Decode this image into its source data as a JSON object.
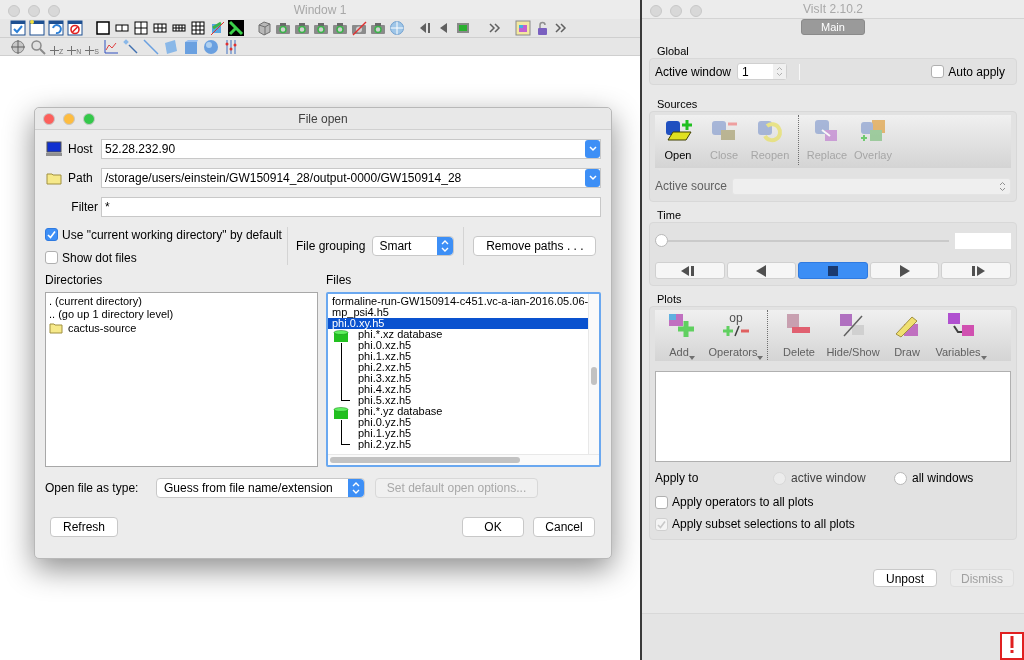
{
  "left_window": {
    "title": "Window 1",
    "toolbar_subscripts": [
      "Z",
      "N",
      "S"
    ]
  },
  "file_dialog": {
    "title": "File open",
    "host": {
      "label": "Host",
      "value": "52.28.232.90"
    },
    "path": {
      "label": "Path",
      "value": "/storage/users/einstein/GW150914_28/output-0000/GW150914_28"
    },
    "filter": {
      "label": "Filter",
      "value": "*"
    },
    "options": [
      {
        "label": "Use \"current working directory\" by default",
        "checked": true
      },
      {
        "label": "Show dot files",
        "checked": false
      }
    ],
    "file_grouping": {
      "label": "File grouping",
      "value": "Smart"
    },
    "remove_paths_button": "Remove paths . . .",
    "directories": {
      "label": "Directories",
      "items": [
        {
          "name": ". (current directory)",
          "kind": "nav"
        },
        {
          "name": ".. (go up 1 directory level)",
          "kind": "nav"
        },
        {
          "name": "cactus-source",
          "kind": "folder"
        }
      ]
    },
    "files": {
      "label": "Files",
      "items": [
        {
          "name": "formaline-run-GW150914-c451.vc-a-ian-2016.05.06-",
          "kind": "file",
          "selected": false
        },
        {
          "name": "mp_psi4.h5",
          "kind": "file",
          "selected": false
        },
        {
          "name": "phi.0.xy.h5",
          "kind": "file",
          "selected": true
        },
        {
          "name": "phi.*.xz database",
          "kind": "database",
          "selected": false,
          "children": [
            {
              "name": "phi.0.xz.h5",
              "selected": false
            },
            {
              "name": "phi.1.xz.h5",
              "selected": false
            },
            {
              "name": "phi.2.xz.h5",
              "selected": false
            },
            {
              "name": "phi.3.xz.h5",
              "selected": false
            },
            {
              "name": "phi.4.xz.h5",
              "selected": false
            },
            {
              "name": "phi.5.xz.h5",
              "selected": false
            }
          ]
        },
        {
          "name": "phi.*.yz database",
          "kind": "database",
          "selected": false,
          "children": [
            {
              "name": "phi.0.yz.h5",
              "selected": false
            },
            {
              "name": "phi.1.yz.h5",
              "selected": false
            },
            {
              "name": "phi.2.yz.h5",
              "selected": false
            }
          ]
        }
      ]
    },
    "open_as": {
      "label": "Open file as type:",
      "value": "Guess from file name/extension"
    },
    "default_options_button": {
      "label": "Set default open options...",
      "disabled": true
    },
    "buttons": [
      {
        "label": "Refresh"
      },
      {
        "label": "OK"
      },
      {
        "label": "Cancel"
      }
    ]
  },
  "main_window": {
    "title": "VisIt 2.10.2",
    "tabs": [
      {
        "label": "Main",
        "selected": true
      }
    ],
    "global": {
      "title": "Global",
      "active_window": {
        "label": "Active window",
        "value": "1"
      },
      "auto_apply": {
        "label": "Auto apply",
        "checked": false
      }
    },
    "sources": {
      "title": "Sources",
      "tools": [
        {
          "label": "Open",
          "disabled": false
        },
        {
          "label": "Close",
          "disabled": true
        },
        {
          "label": "Reopen",
          "disabled": true
        },
        {
          "label": "Replace",
          "disabled": true
        },
        {
          "label": "Overlay",
          "disabled": true
        }
      ],
      "active_source": {
        "label": "Active source",
        "disabled": true
      }
    },
    "time": {
      "title": "Time",
      "slider": {
        "level": 0
      },
      "controls": [
        {
          "kind": "step-back",
          "selected": false
        },
        {
          "kind": "play-back",
          "selected": false
        },
        {
          "kind": "stop",
          "selected": true
        },
        {
          "kind": "play",
          "selected": false
        },
        {
          "kind": "step-forward",
          "selected": false
        }
      ]
    },
    "plots": {
      "title": "Plots",
      "tools": [
        {
          "label": "Add",
          "has_menu": true
        },
        {
          "label": "Operators",
          "has_menu": true,
          "icon_text": "op"
        },
        {
          "label": "Delete",
          "has_menu": false
        },
        {
          "label": "Hide/Show",
          "has_menu": false
        },
        {
          "label": "Draw",
          "has_menu": false
        },
        {
          "label": "Variables",
          "has_menu": true
        }
      ],
      "apply_to": {
        "label": "Apply to",
        "options": [
          {
            "label": "active window",
            "selected": false,
            "disabled": true
          },
          {
            "label": "all windows",
            "selected": false,
            "disabled": false
          }
        ]
      },
      "checks": [
        {
          "label": "Apply operators to all plots",
          "checked": false,
          "disabled": false
        },
        {
          "label": "Apply subset selections to all plots",
          "checked": true,
          "disabled": true
        }
      ]
    },
    "buttons": [
      {
        "label": "Unpost",
        "disabled": false
      },
      {
        "label": "Dismiss",
        "disabled": true
      }
    ]
  }
}
